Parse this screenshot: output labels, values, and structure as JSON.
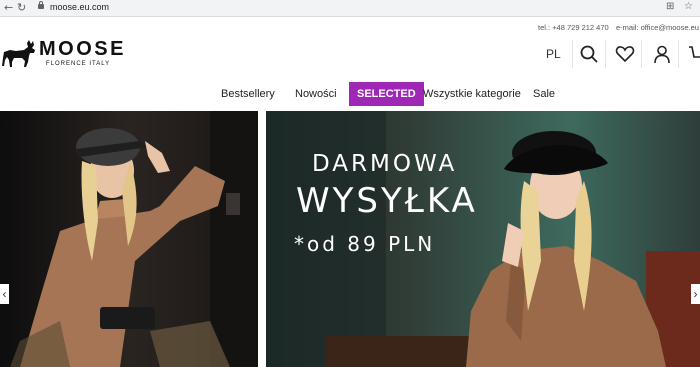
{
  "browser": {
    "url": "moose.eu.com",
    "back_icon": "arrow-left-icon",
    "forward_icon": "arrow-right-icon",
    "reload_icon": "reload-icon",
    "back_glyph": "←",
    "forward_glyph": "→",
    "reload_glyph": "↻",
    "translate_glyph": "⊞",
    "star_glyph": "☆"
  },
  "contact": {
    "phone": "tel.: +48 729 212 470",
    "email": "e-mail: office@moose.eu"
  },
  "logo": {
    "name": "MOOSE",
    "tagline": "FLORENCE ITALY"
  },
  "header": {
    "language": "PL"
  },
  "nav": {
    "items": [
      "Bestsellery",
      "Nowości",
      "SELECTED",
      "Wszystkie kategorie",
      "Sale"
    ],
    "selected_color": "#9e28b5"
  },
  "hero": {
    "line1": "DARMOWA",
    "line2": "WYSYŁKA",
    "line3": "*od 89 PLN",
    "left_arrow": "‹",
    "right_arrow": "›"
  }
}
